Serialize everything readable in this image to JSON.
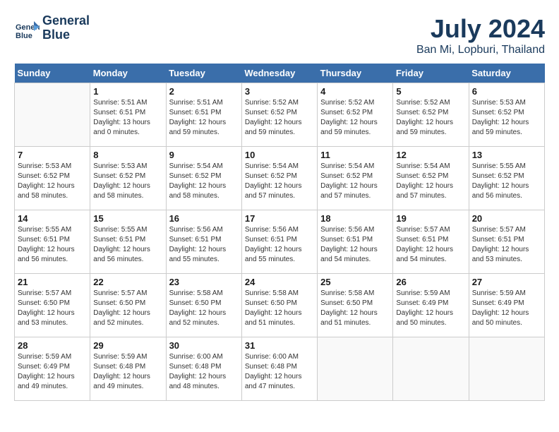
{
  "header": {
    "logo_line1": "General",
    "logo_line2": "Blue",
    "month": "July 2024",
    "location": "Ban Mi, Lopburi, Thailand"
  },
  "days_of_week": [
    "Sunday",
    "Monday",
    "Tuesday",
    "Wednesday",
    "Thursday",
    "Friday",
    "Saturday"
  ],
  "weeks": [
    [
      {
        "num": "",
        "info": ""
      },
      {
        "num": "1",
        "info": "Sunrise: 5:51 AM\nSunset: 6:51 PM\nDaylight: 13 hours\nand 0 minutes."
      },
      {
        "num": "2",
        "info": "Sunrise: 5:51 AM\nSunset: 6:51 PM\nDaylight: 12 hours\nand 59 minutes."
      },
      {
        "num": "3",
        "info": "Sunrise: 5:52 AM\nSunset: 6:52 PM\nDaylight: 12 hours\nand 59 minutes."
      },
      {
        "num": "4",
        "info": "Sunrise: 5:52 AM\nSunset: 6:52 PM\nDaylight: 12 hours\nand 59 minutes."
      },
      {
        "num": "5",
        "info": "Sunrise: 5:52 AM\nSunset: 6:52 PM\nDaylight: 12 hours\nand 59 minutes."
      },
      {
        "num": "6",
        "info": "Sunrise: 5:53 AM\nSunset: 6:52 PM\nDaylight: 12 hours\nand 59 minutes."
      }
    ],
    [
      {
        "num": "7",
        "info": "Sunrise: 5:53 AM\nSunset: 6:52 PM\nDaylight: 12 hours\nand 58 minutes."
      },
      {
        "num": "8",
        "info": "Sunrise: 5:53 AM\nSunset: 6:52 PM\nDaylight: 12 hours\nand 58 minutes."
      },
      {
        "num": "9",
        "info": "Sunrise: 5:54 AM\nSunset: 6:52 PM\nDaylight: 12 hours\nand 58 minutes."
      },
      {
        "num": "10",
        "info": "Sunrise: 5:54 AM\nSunset: 6:52 PM\nDaylight: 12 hours\nand 57 minutes."
      },
      {
        "num": "11",
        "info": "Sunrise: 5:54 AM\nSunset: 6:52 PM\nDaylight: 12 hours\nand 57 minutes."
      },
      {
        "num": "12",
        "info": "Sunrise: 5:54 AM\nSunset: 6:52 PM\nDaylight: 12 hours\nand 57 minutes."
      },
      {
        "num": "13",
        "info": "Sunrise: 5:55 AM\nSunset: 6:52 PM\nDaylight: 12 hours\nand 56 minutes."
      }
    ],
    [
      {
        "num": "14",
        "info": "Sunrise: 5:55 AM\nSunset: 6:51 PM\nDaylight: 12 hours\nand 56 minutes."
      },
      {
        "num": "15",
        "info": "Sunrise: 5:55 AM\nSunset: 6:51 PM\nDaylight: 12 hours\nand 56 minutes."
      },
      {
        "num": "16",
        "info": "Sunrise: 5:56 AM\nSunset: 6:51 PM\nDaylight: 12 hours\nand 55 minutes."
      },
      {
        "num": "17",
        "info": "Sunrise: 5:56 AM\nSunset: 6:51 PM\nDaylight: 12 hours\nand 55 minutes."
      },
      {
        "num": "18",
        "info": "Sunrise: 5:56 AM\nSunset: 6:51 PM\nDaylight: 12 hours\nand 54 minutes."
      },
      {
        "num": "19",
        "info": "Sunrise: 5:57 AM\nSunset: 6:51 PM\nDaylight: 12 hours\nand 54 minutes."
      },
      {
        "num": "20",
        "info": "Sunrise: 5:57 AM\nSunset: 6:51 PM\nDaylight: 12 hours\nand 53 minutes."
      }
    ],
    [
      {
        "num": "21",
        "info": "Sunrise: 5:57 AM\nSunset: 6:50 PM\nDaylight: 12 hours\nand 53 minutes."
      },
      {
        "num": "22",
        "info": "Sunrise: 5:57 AM\nSunset: 6:50 PM\nDaylight: 12 hours\nand 52 minutes."
      },
      {
        "num": "23",
        "info": "Sunrise: 5:58 AM\nSunset: 6:50 PM\nDaylight: 12 hours\nand 52 minutes."
      },
      {
        "num": "24",
        "info": "Sunrise: 5:58 AM\nSunset: 6:50 PM\nDaylight: 12 hours\nand 51 minutes."
      },
      {
        "num": "25",
        "info": "Sunrise: 5:58 AM\nSunset: 6:50 PM\nDaylight: 12 hours\nand 51 minutes."
      },
      {
        "num": "26",
        "info": "Sunrise: 5:59 AM\nSunset: 6:49 PM\nDaylight: 12 hours\nand 50 minutes."
      },
      {
        "num": "27",
        "info": "Sunrise: 5:59 AM\nSunset: 6:49 PM\nDaylight: 12 hours\nand 50 minutes."
      }
    ],
    [
      {
        "num": "28",
        "info": "Sunrise: 5:59 AM\nSunset: 6:49 PM\nDaylight: 12 hours\nand 49 minutes."
      },
      {
        "num": "29",
        "info": "Sunrise: 5:59 AM\nSunset: 6:48 PM\nDaylight: 12 hours\nand 49 minutes."
      },
      {
        "num": "30",
        "info": "Sunrise: 6:00 AM\nSunset: 6:48 PM\nDaylight: 12 hours\nand 48 minutes."
      },
      {
        "num": "31",
        "info": "Sunrise: 6:00 AM\nSunset: 6:48 PM\nDaylight: 12 hours\nand 47 minutes."
      },
      {
        "num": "",
        "info": ""
      },
      {
        "num": "",
        "info": ""
      },
      {
        "num": "",
        "info": ""
      }
    ]
  ]
}
